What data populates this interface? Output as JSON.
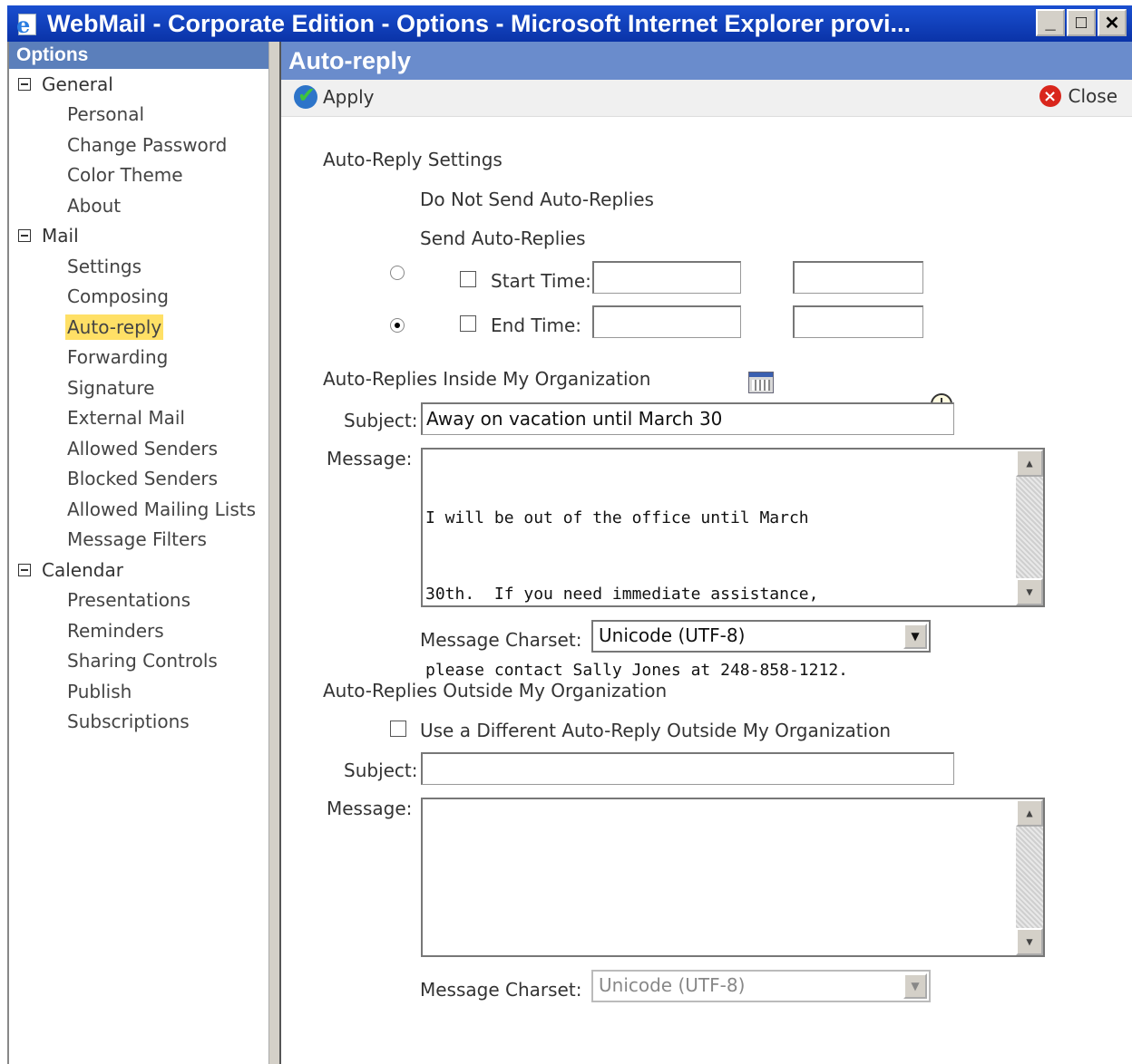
{
  "window": {
    "title": "WebMail - Corporate Edition - Options - Microsoft Internet Explorer provi...",
    "minimize": "_",
    "maximize": "□",
    "close": "✕"
  },
  "sidebar": {
    "header": "Options",
    "groups": [
      {
        "label": "General",
        "items": [
          "Personal",
          "Change Password",
          "Color Theme",
          "About"
        ]
      },
      {
        "label": "Mail",
        "items": [
          "Settings",
          "Composing",
          "Auto-reply",
          "Forwarding",
          "Signature",
          "External Mail",
          "Allowed Senders",
          "Blocked Senders",
          "Allowed Mailing Lists",
          "Message Filters"
        ]
      },
      {
        "label": "Calendar",
        "items": [
          "Presentations",
          "Reminders",
          "Sharing Controls",
          "Publish",
          "Subscriptions"
        ]
      }
    ],
    "active_item": "Auto-reply"
  },
  "main": {
    "title": "Auto-reply",
    "toolbar": {
      "apply": "Apply",
      "close": "Close"
    },
    "settings": {
      "title": "Auto-Reply Settings",
      "option_off": "Do Not Send Auto-Replies",
      "option_on": "Send Auto-Replies",
      "selected": "Send Auto-Replies",
      "start_label": "Start Time:",
      "end_label": "End Time:"
    },
    "inside": {
      "title": "Auto-Replies Inside My Organization",
      "subject_label": "Subject:",
      "subject_value": "Away on vacation until March 30",
      "message_label": "Message:",
      "message_lines": [
        "I will be out of the office until March",
        "30th.  If you need immediate assistance,",
        "please contact Sally Jones at 248-858-1212."
      ],
      "charset_label": "Message Charset:",
      "charset_value": "Unicode (UTF-8)"
    },
    "outside": {
      "title": "Auto-Replies Outside My Organization",
      "checkbox_label": "Use a Different Auto-Reply Outside My Organization",
      "subject_label": "Subject:",
      "message_label": "Message:",
      "charset_label": "Message Charset:",
      "charset_value": "Unicode (UTF-8)"
    }
  }
}
